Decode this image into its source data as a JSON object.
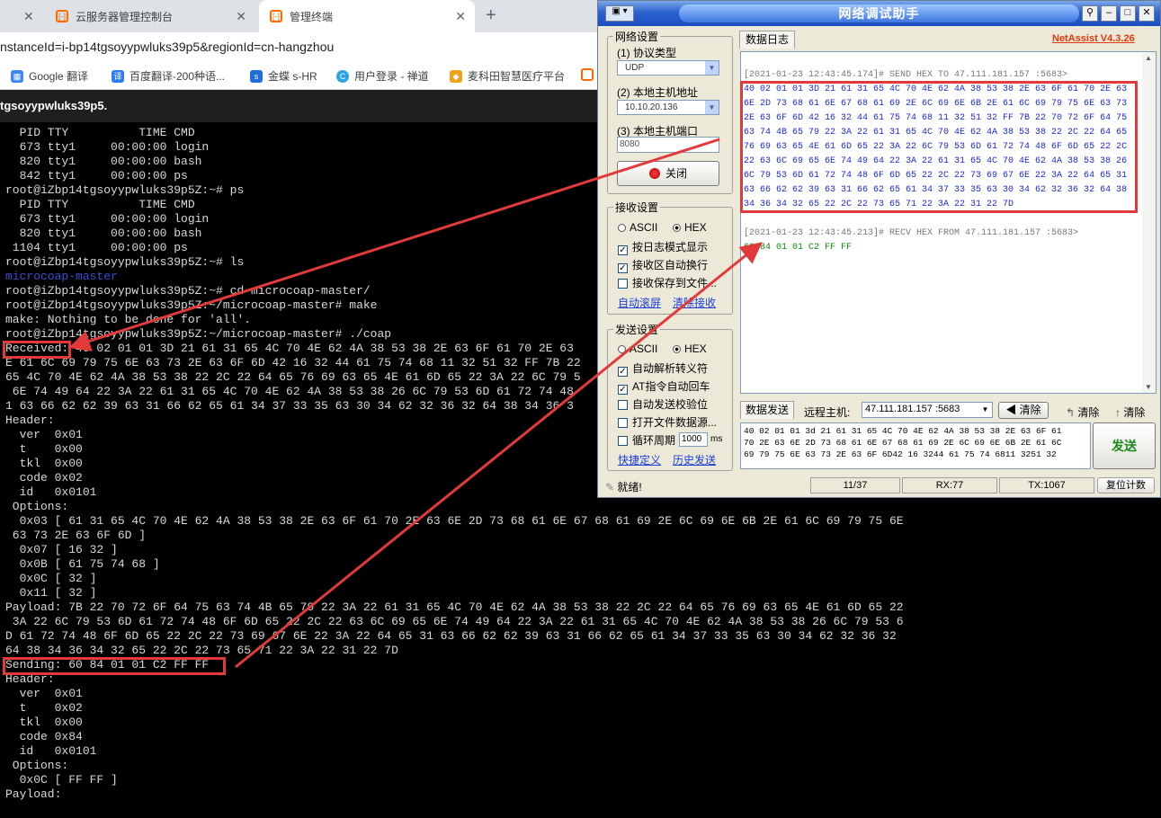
{
  "browser": {
    "tabs": [
      {
        "label": "云服务器管理控制台",
        "icon": "aliyun-icon"
      },
      {
        "label": "管理终端",
        "icon": "aliyun-icon"
      }
    ],
    "url": "nstanceId=i-bp14tgsoyypwluks39p5&regionId=cn-hangzhou",
    "bookmarks": [
      "Google 翻译",
      "百度翻译-200种语...",
      "金蝶 s-HR",
      "用户登录 - 禅道",
      "麦科田智慧医疗平台"
    ],
    "terminal_title": "tgsoyypwluks39p5."
  },
  "terminal": {
    "lines": [
      "  PID TTY          TIME CMD",
      "  673 tty1     00:00:00 login",
      "  820 tty1     00:00:00 bash",
      "  842 tty1     00:00:00 ps",
      "root@iZbp14tgsoyypwluks39p5Z:~# ps",
      "  PID TTY          TIME CMD",
      "  673 tty1     00:00:00 login",
      "  820 tty1     00:00:00 bash",
      " 1104 tty1     00:00:00 ps",
      "root@iZbp14tgsoyypwluks39p5Z:~# ls",
      "microcoap-master",
      "root@iZbp14tgsoyypwluks39p5Z:~# cd microcoap-master/",
      "root@iZbp14tgsoyypwluks39p5Z:~/microcoap-master# make",
      "make: Nothing to be done for 'all'.",
      "root@iZbp14tgsoyypwluks39p5Z:~/microcoap-master# ./coap",
      "Received: 40 02 01 01 3D 21 61 31 65 4C 70 4E 62 4A 38 53 38 2E 63 6F 61 70 2E 63",
      "E 61 6C 69 79 75 6E 63 73 2E 63 6F 6D 42 16 32 44 61 75 74 68 11 32 51 32 FF 7B 22",
      "65 4C 70 4E 62 4A 38 53 38 22 2C 22 64 65 76 69 63 65 4E 61 6D 65 22 3A 22 6C 79 5",
      " 6E 74 49 64 22 3A 22 61 31 65 4C 70 4E 62 4A 38 53 38 26 6C 79 53 6D 61 72 74 48",
      "1 63 66 62 62 39 63 31 66 62 65 61 34 37 33 35 63 30 34 62 32 36 32 64 38 34 36 3",
      "Header:",
      "  ver  0x01",
      "  t    0x00",
      "  tkl  0x00",
      "  code 0x02",
      "  id   0x0101",
      " Options:",
      "  0x03 [ 61 31 65 4C 70 4E 62 4A 38 53 38 2E 63 6F 61 70 2E 63 6E 2D 73 68 61 6E 67 68 61 69 2E 6C 69 6E 6B 2E 61 6C 69 79 75 6E",
      " 63 73 2E 63 6F 6D ]",
      "  0x07 [ 16 32 ]",
      "  0x0B [ 61 75 74 68 ]",
      "  0x0C [ 32 ]",
      "  0x11 [ 32 ]",
      "Payload: 7B 22 70 72 6F 64 75 63 74 4B 65 79 22 3A 22 61 31 65 4C 70 4E 62 4A 38 53 38 22 2C 22 64 65 76 69 63 65 4E 61 6D 65 22",
      " 3A 22 6C 79 53 6D 61 72 74 48 6F 6D 65 22 2C 22 63 6C 69 65 6E 74 49 64 22 3A 22 61 31 65 4C 70 4E 62 4A 38 53 38 26 6C 79 53 6",
      "D 61 72 74 48 6F 6D 65 22 2C 22 73 69 67 6E 22 3A 22 64 65 31 63 66 62 62 39 63 31 66 62 65 61 34 37 33 35 63 30 34 62 32 36 32",
      "64 38 34 36 34 32 65 22 2C 22 73 65 71 22 3A 22 31 22 7D",
      "Sending: 60 84 01 01 C2 FF FF",
      "Header:",
      "  ver  0x01",
      "  t    0x02",
      "  tkl  0x00",
      "  code 0x84",
      "  id   0x0101",
      " Options:",
      "  0x0C [ FF FF ]",
      "Payload:"
    ]
  },
  "netassist": {
    "title": "网络调试助手",
    "version": "NetAssist V4.3.26",
    "network_settings": {
      "legend": "网络设置",
      "protocol_label": "(1) 协议类型",
      "protocol_value": "UDP",
      "local_ip_label": "(2) 本地主机地址",
      "local_ip_value": "10.10.20.136",
      "local_port_label": "(3) 本地主机端口",
      "local_port_value": "8080",
      "close_button": "关闭"
    },
    "receive_settings": {
      "legend": "接收设置",
      "ascii": "ASCII",
      "hex": "HEX",
      "log_mode": "按日志模式显示",
      "auto_wrap": "接收区自动换行",
      "save_file": "接收保存到文件...",
      "auto_scroll": "自动滚屏",
      "clear_receive": "清除接收"
    },
    "send_settings": {
      "legend": "发送设置",
      "ascii": "ASCII",
      "hex": "HEX",
      "auto_escape": "自动解析转义符",
      "at_auto_cr": "AT指令自动回车",
      "auto_checksum": "自动发送校验位",
      "open_file": "打开文件数据源...",
      "loop_period": "循环周期",
      "loop_value": "1000",
      "loop_unit": "ms",
      "shortcuts": "快捷定义",
      "history": "历史发送"
    },
    "log_tab": "数据日志",
    "log": {
      "send_header": "[2021-01-23 12:43:45.174]# SEND HEX TO 47.111.181.157 :5683>",
      "send_lines": [
        "40 02 01 01 3D 21 61 31 65 4C 70 4E 62 4A 38 53 38 2E 63 6F 61 70 2E 63",
        "6E 2D 73 68 61 6E 67 68 61 69 2E 6C 69 6E 6B 2E 61 6C 69 79 75 6E 63 73",
        "2E 63 6F 6D 42 16 32 44 61 75 74 68 11 32 51 32 FF 7B 22 70 72 6F 64 75",
        "63 74 4B 65 79 22 3A 22 61 31 65 4C 70 4E 62 4A 38 53 38 22 2C 22 64 65",
        "76 69 63 65 4E 61 6D 65 22 3A 22 6C 79 53 6D 61 72 74 48 6F 6D 65 22 2C",
        "22 63 6C 69 65 6E 74 49 64 22 3A 22 61 31 65 4C 70 4E 62 4A 38 53 38 26",
        "6C 79 53 6D 61 72 74 48 6F 6D 65 22 2C 22 73 69 67 6E 22 3A 22 64 65 31",
        "63 66 62 62 39 63 31 66 62 65 61 34 37 33 35 63 30 34 62 32 36 32 64 38",
        "34 36 34 32 65 22 2C 22 73 65 71 22 3A 22 31 22 7D"
      ],
      "recv_header": "[2021-01-23 12:43:45.213]# RECV HEX FROM 47.111.181.157 :5683>",
      "recv_line": "60 84 01 01 C2 FF FF"
    },
    "send_bar": {
      "tab": "数据发送",
      "remote_label": "远程主机:",
      "remote_value": "47.111.181.157 :5683",
      "clear1": "清除",
      "clear2": "清除",
      "clear3": "清除"
    },
    "send_text": [
      "40 02 01 01 3d 21 61 31 65 4C 70 4E 62 4A 38 53 38 2E 63 6F 61",
      "70 2E 63 6E 2D 73 68 61 6E 67 68 61 69 2E 6C 69 6E 6B 2E 61 6C",
      "69 79 75 6E 63 73 2E 63 6F 6D42 16 3244 61 75 74 6811 3251 32"
    ],
    "send_button": "发送",
    "status": {
      "ready": "就绪!",
      "frames": "11/37",
      "rx": "RX:77",
      "tx": "TX:1067",
      "reset": "复位计数"
    }
  }
}
